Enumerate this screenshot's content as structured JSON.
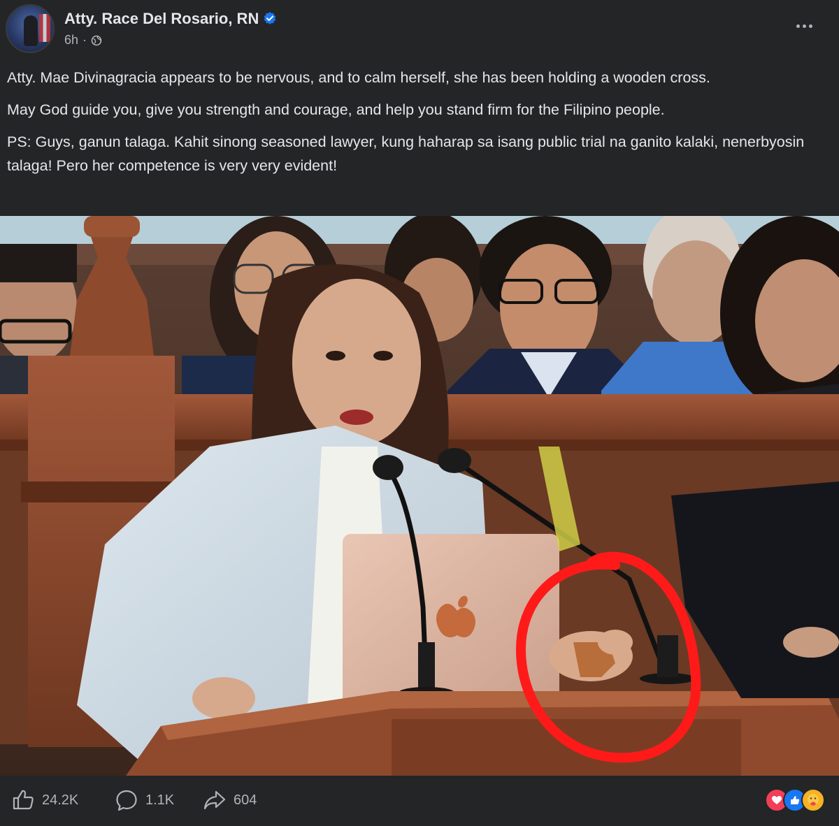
{
  "post": {
    "author": "Atty. Race Del Rosario, RN",
    "time": "6h",
    "separator": "·",
    "paragraphs": [
      "Atty. Mae Divinagracia appears to be nervous, and to calm herself, she has been holding a wooden cross.",
      "May God guide you, give you strength and courage, and help you stand firm for the Filipino people.",
      "PS: Guys, ganun talaga. Kahit sinong seasoned lawyer, kung haharap sa isang public trial na ganito kalaki, nenerbyosin talaga! Pero her competence is very very evident!"
    ]
  },
  "stats": {
    "likes": "24.2K",
    "comments": "1.1K",
    "shares": "604"
  },
  "icons": {
    "verified": "verified-badge-icon",
    "privacy": "globe-icon",
    "more": "more-options-icon",
    "like": "thumbs-up-icon",
    "comment": "comment-bubble-icon",
    "share": "share-arrow-icon",
    "reactions": [
      "love-reaction-icon",
      "like-reaction-icon",
      "care-reaction-icon"
    ]
  },
  "colors": {
    "background": "#242526",
    "text": "#e4e6eb",
    "secondary_text": "#b0b3b8",
    "verified_blue": "#1877f2",
    "annotation_red": "#ff1a1a"
  }
}
